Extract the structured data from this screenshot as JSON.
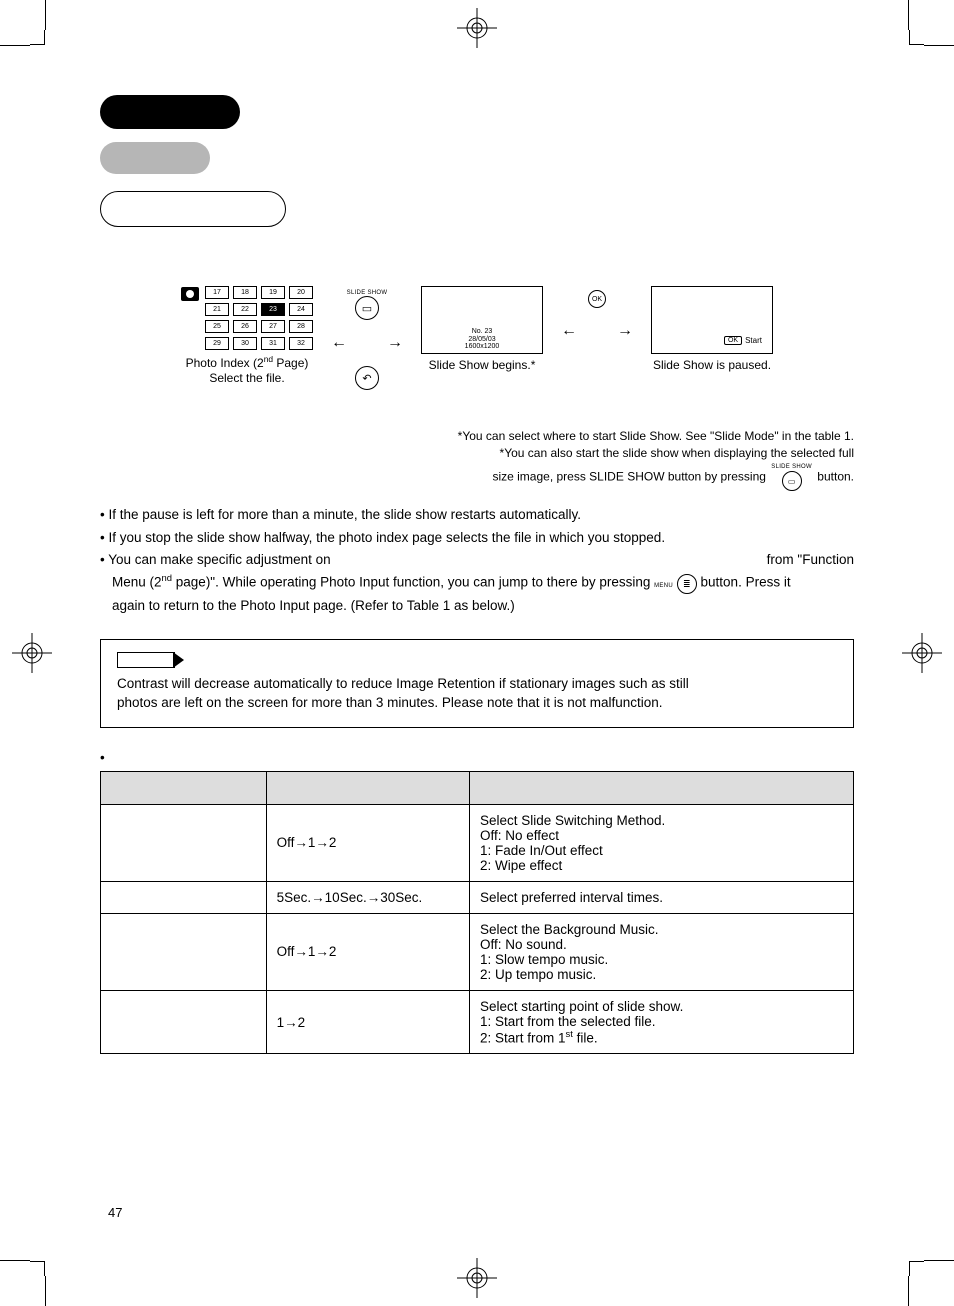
{
  "header": {
    "black": "",
    "gray": "",
    "capsule": ""
  },
  "flow": {
    "grid": [
      "17",
      "18",
      "19",
      "20",
      "21",
      "22",
      "23",
      "24",
      "25",
      "26",
      "27",
      "28",
      "29",
      "30",
      "31",
      "32"
    ],
    "selected_index": 6,
    "caption_index_line1": "Photo Index (2",
    "caption_index_sup": "nd",
    "caption_index_line1b": " Page)",
    "caption_index_line2": "Select the file.",
    "slideshow_label": "SLIDE SHOW",
    "screen1_meta_l1": "No. 23",
    "screen1_meta_l2": "28/05/03",
    "screen1_meta_l3": "1600x1200",
    "caption_screen1": "Slide Show begins.*",
    "ok": "OK",
    "screen2_ok": "OK",
    "screen2_start": "Start",
    "caption_screen2": "Slide Show is paused."
  },
  "footnotes": {
    "star1": "*You can select where to start Slide Show. See \"Slide Mode\" in the table 1.",
    "star2a": "*You can also start the slide show when displaying the selected full",
    "star2b": "size image, press SLIDE SHOW button by pressing",
    "star2c": " button.",
    "icon_label": "SLIDE SHOW"
  },
  "bullets": {
    "b1": "• If the pause is left for more than a minute, the slide show restarts automatically.",
    "b2": "• If you stop the slide show halfway, the photo index page selects the file in which you stopped.",
    "b3a": "• You can make specific adjustment on",
    "b3b": "from \"Function",
    "b4a": "Menu (2",
    "b4sup": "nd",
    "b4b": " page)\". While operating Photo Input function, you can jump to there by pressing",
    "b4c": "button.  Press it",
    "b4_icon_label": "MENU",
    "b5": "again to return to the Photo Input page. (Refer to Table 1 as below.)"
  },
  "note": {
    "line1": "Contrast will decrease automatically to reduce Image Retention if stationary images such as still",
    "line2": "photos are left on the screen for more than 3 minutes. Please note that it is not malfunction."
  },
  "table_bullet": "•",
  "table": {
    "headers": [
      "",
      "",
      ""
    ],
    "rows": [
      {
        "item": "",
        "select": "Off→1→2",
        "desc": "Select Slide Switching Method.\nOff: No effect\n1: Fade In/Out effect\n2: Wipe effect"
      },
      {
        "item": "",
        "select": "5Sec.→10Sec.→30Sec.",
        "desc": "Select preferred interval times."
      },
      {
        "item": "",
        "select": "Off→1→2",
        "desc": "Select the Background Music.\nOff: No sound.\n1: Slow tempo music.\n2: Up tempo music."
      },
      {
        "item": "",
        "select": "1→2",
        "desc_a": "Select starting point of slide show.\n1: Start from the selected file.\n2: Start from 1",
        "desc_sup": "st",
        "desc_b": " file."
      }
    ]
  },
  "page_number": "47"
}
